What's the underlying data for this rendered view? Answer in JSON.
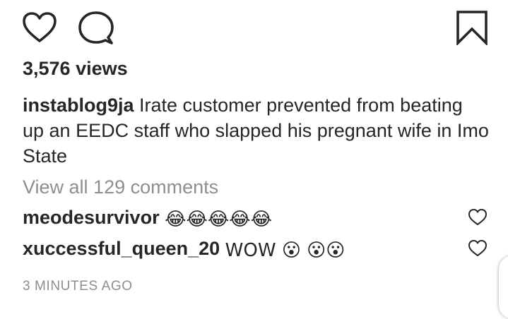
{
  "actions": {
    "like_icon": "heart-outline-icon",
    "comment_icon": "comment-bubble-icon",
    "save_icon": "bookmark-outline-icon"
  },
  "post": {
    "views": "3,576 views",
    "caption_user": "instablog9ja",
    "caption_text": " Irate customer prevented from beating up an EEDC staff who slapped his pregnant wife in Imo State",
    "view_all_comments": "View all 129 comments",
    "timestamp": "3 MINUTES AGO"
  },
  "comments": [
    {
      "user": "meodesurvivor",
      "text": "😂😂😂😂😂"
    },
    {
      "user": "xuccessful_queen_20",
      "text": "WOW 😮 😮😮"
    }
  ]
}
